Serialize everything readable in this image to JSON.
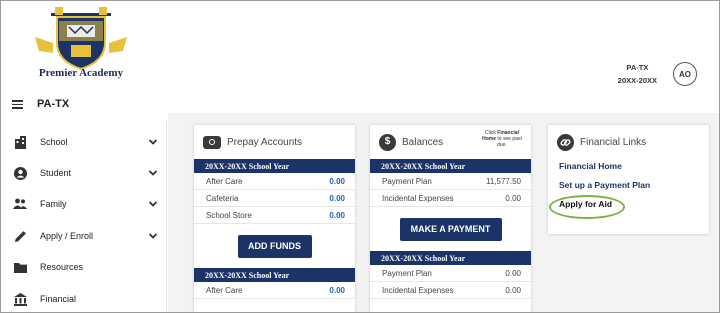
{
  "header": {
    "school_name": "Premier Academy",
    "tenant": "PA-TX",
    "school_year": "20XX-20XX",
    "user_initials": "AO",
    "district_label": "PA-TX"
  },
  "sidebar": {
    "items": [
      {
        "label": "School",
        "icon": "building-icon",
        "expandable": true
      },
      {
        "label": "Student",
        "icon": "person-circle-icon",
        "expandable": true
      },
      {
        "label": "Family",
        "icon": "people-icon",
        "expandable": true
      },
      {
        "label": "Apply / Enroll",
        "icon": "pencil-icon",
        "expandable": true
      },
      {
        "label": "Resources",
        "icon": "folder-icon",
        "expandable": false
      },
      {
        "label": "Financial",
        "icon": "bank-icon",
        "expandable": false
      }
    ]
  },
  "prepay": {
    "title": "Prepay Accounts",
    "section_title": "20XX-20XX School Year",
    "rows": [
      {
        "label": "After Care",
        "amount": "0.00"
      },
      {
        "label": "Cafeteria",
        "amount": "0.00"
      },
      {
        "label": "School Store",
        "amount": "0.00"
      }
    ],
    "button_label": "ADD FUNDS",
    "section2_title": "20XX-20XX School Year",
    "rows2": [
      {
        "label": "After Care",
        "amount": "0.00"
      }
    ]
  },
  "balances": {
    "title": "Balances",
    "note_prefix": "Click",
    "note_link": "Financial Home",
    "note_suffix": "to see past due.",
    "section_title": "20XX-20XX School Year",
    "rows": [
      {
        "label": "Payment Plan",
        "amount": "11,577.50"
      },
      {
        "label": "Incidental Expenses",
        "amount": "0.00"
      }
    ],
    "button_label": "MAKE A PAYMENT",
    "section2_title": "20XX-20XX School Year",
    "rows2": [
      {
        "label": "Payment Plan",
        "amount": "0.00"
      },
      {
        "label": "Incidental Expenses",
        "amount": "0.00"
      }
    ]
  },
  "financial_links": {
    "title": "Financial Links",
    "links": [
      "Financial Home",
      "Set up a Payment Plan",
      "Apply for Aid"
    ]
  },
  "colors": {
    "navy": "#1b3366",
    "amount_blue": "#1e62c0",
    "highlight_green": "#7bb343"
  }
}
